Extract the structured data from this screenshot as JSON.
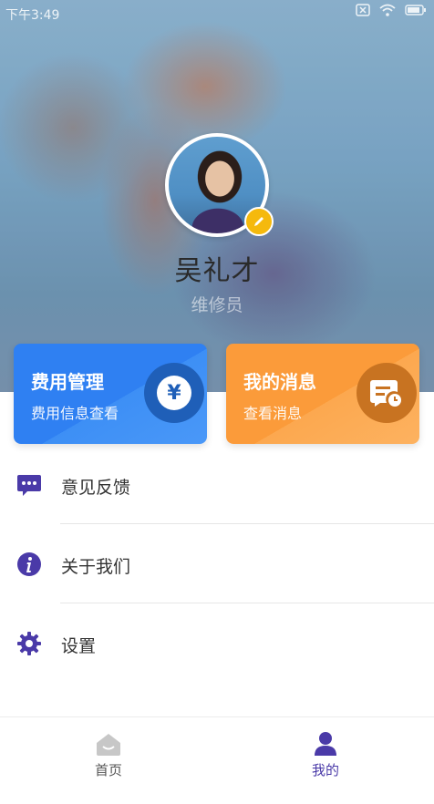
{
  "status_bar": {
    "time": "下午3:49"
  },
  "profile": {
    "name": "吴礼才",
    "role": "维修员"
  },
  "cards": {
    "fee": {
      "title": "费用管理",
      "subtitle": "费用信息查看",
      "icon_symbol": "¥"
    },
    "messages": {
      "title": "我的消息",
      "subtitle": "查看消息"
    }
  },
  "menu": {
    "items": [
      {
        "label": "意见反馈",
        "icon": "feedback-icon"
      },
      {
        "label": "关于我们",
        "icon": "info-icon"
      },
      {
        "label": "设置",
        "icon": "gear-icon"
      }
    ]
  },
  "bottom_nav": {
    "items": [
      {
        "label": "首页",
        "icon": "home-icon",
        "active": false
      },
      {
        "label": "我的",
        "icon": "user-icon",
        "active": true
      }
    ]
  },
  "colors": {
    "accent": "#4a3aa8",
    "fee_card": "#2f80f2",
    "message_card": "#fb9b3a",
    "edit_badge": "#f5b90d"
  }
}
